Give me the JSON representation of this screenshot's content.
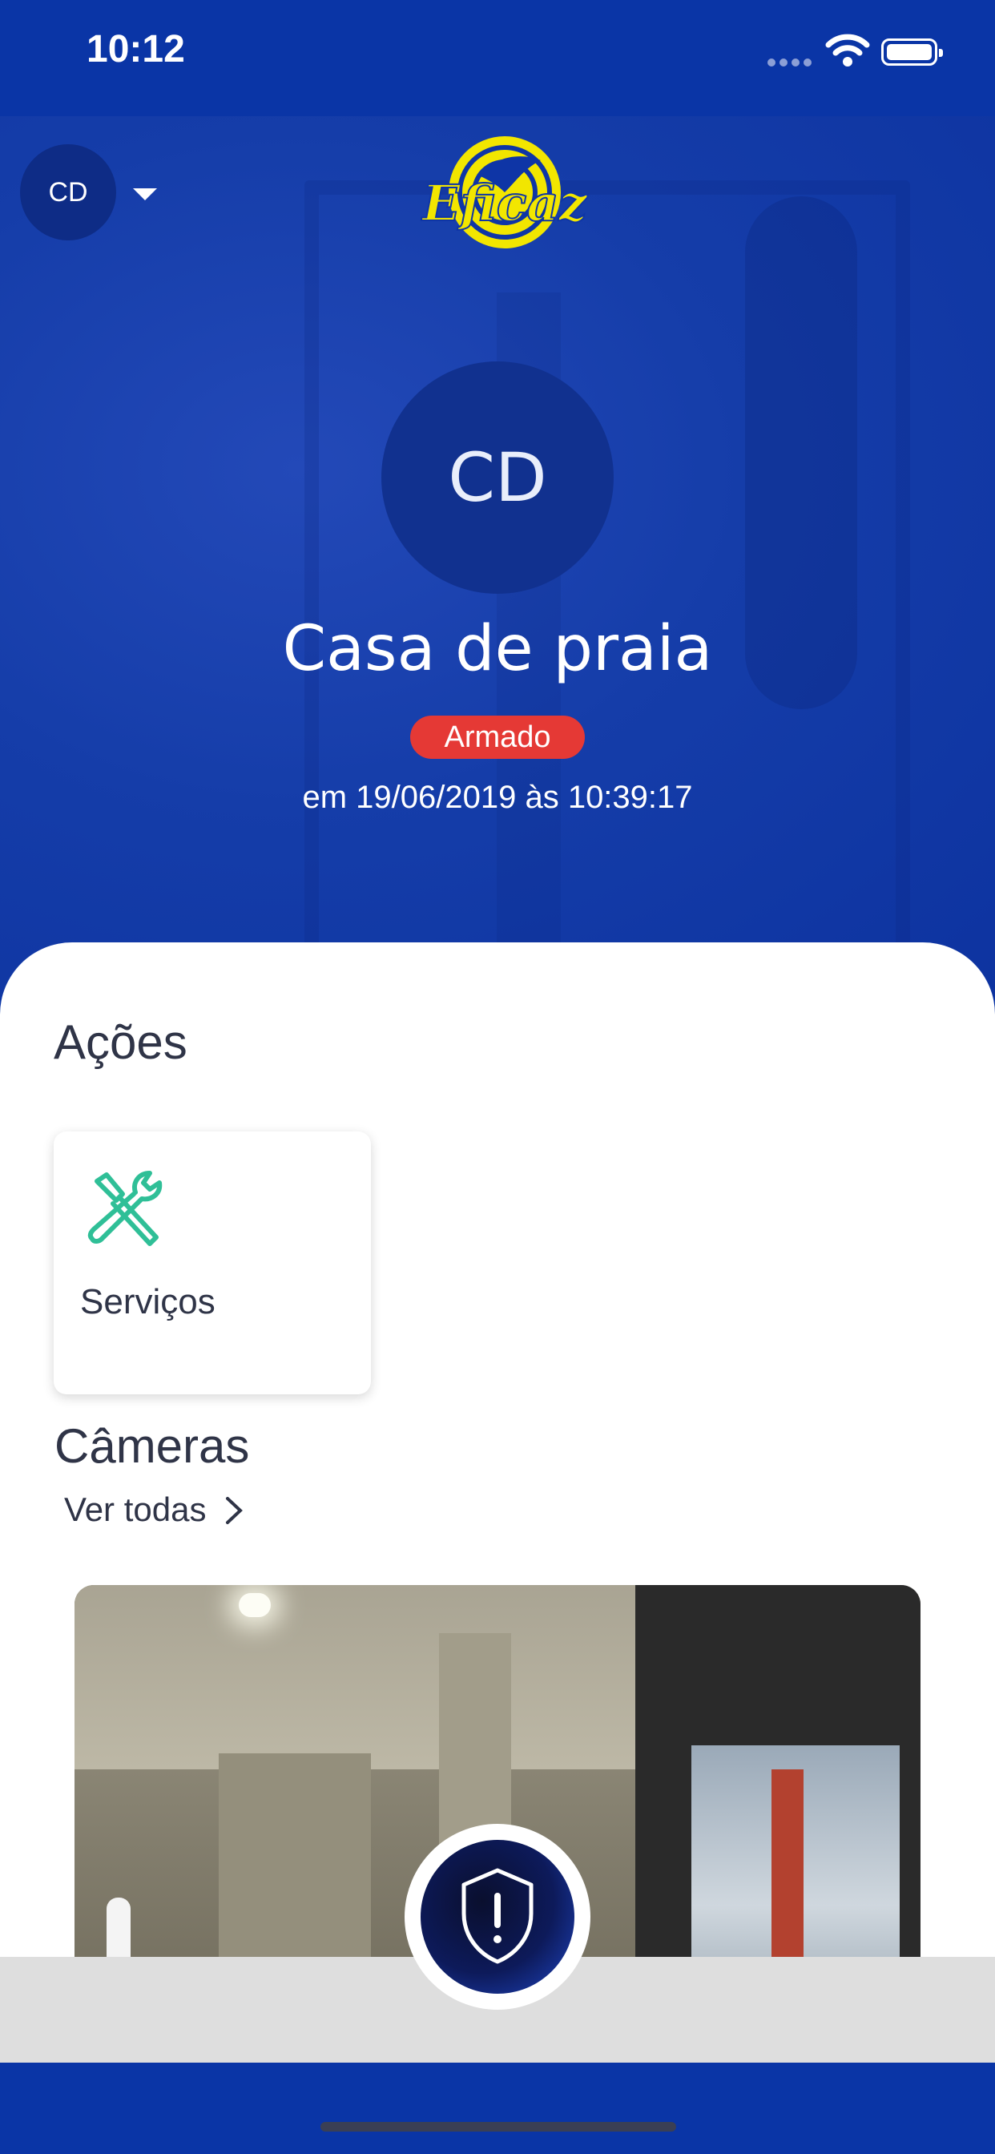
{
  "status_bar": {
    "time": "10:12"
  },
  "header": {
    "site_avatar_initials": "CD",
    "logo_text": "Eficaz"
  },
  "site": {
    "avatar_initials": "CD",
    "name": "Casa de praia",
    "status": "Armado",
    "status_date": "em 19/06/2019 às 10:39:17"
  },
  "actions": {
    "title": "Ações",
    "items": [
      {
        "label": "Serviços",
        "icon": "tools-icon"
      }
    ]
  },
  "cameras": {
    "title": "Câmeras",
    "see_all_label": "Ver todas"
  },
  "colors": {
    "primary": "#0a35a6",
    "armed": "#e53935",
    "accent_green": "#2fbf97",
    "logo_yellow": "#f2e600"
  }
}
